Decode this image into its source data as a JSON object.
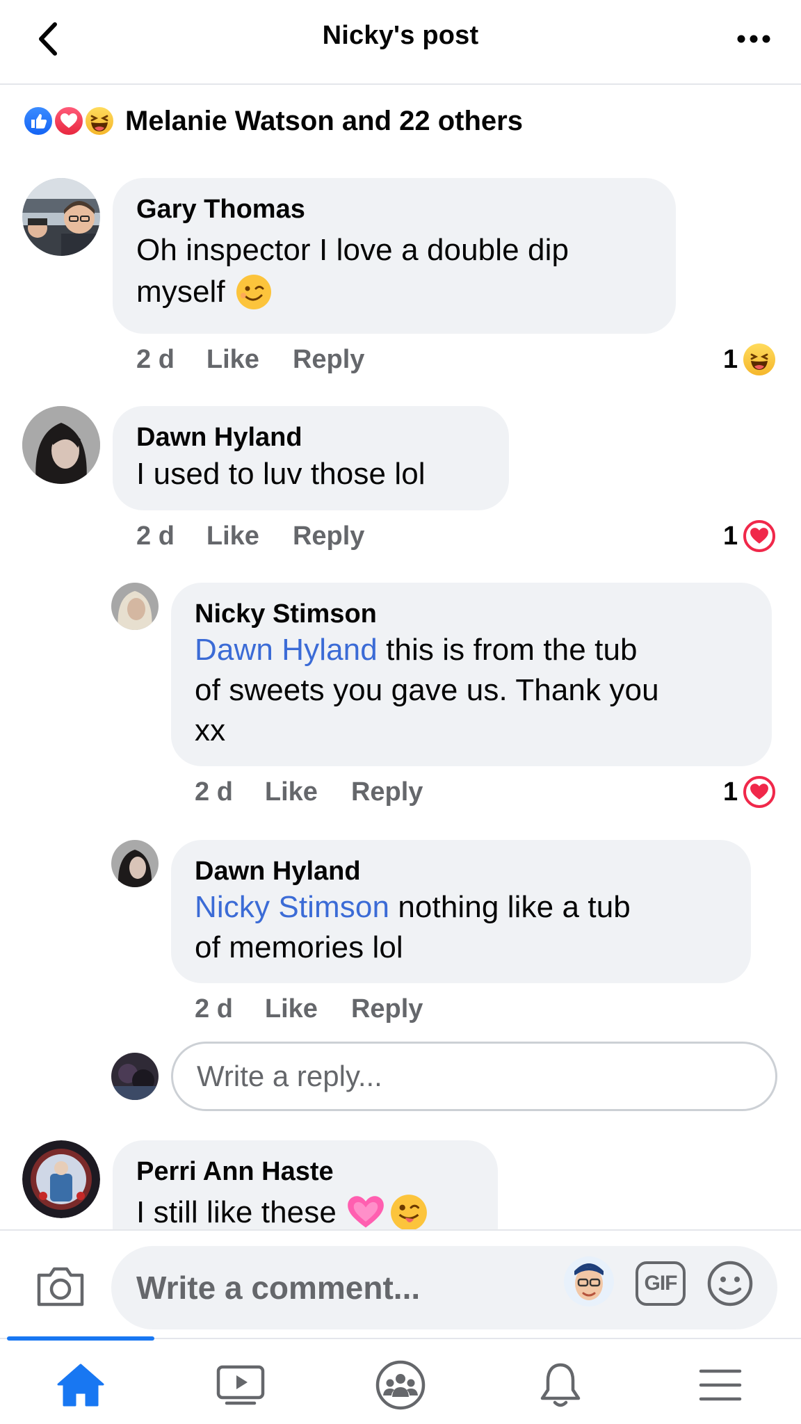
{
  "header": {
    "title": "Nicky's post",
    "back_icon": "chevron-left-icon",
    "more_icon": "more-horizontal-icon"
  },
  "reactions": {
    "icons": [
      "like-icon",
      "love-icon",
      "haha-icon"
    ],
    "summary": "Melanie Watson and 22 others"
  },
  "comments": [
    {
      "author": "Gary Thomas",
      "text_line1": "Oh inspector I love a double dip",
      "text_line2": "myself",
      "emoji": "wink",
      "time": "2 d",
      "like_label": "Like",
      "reply_label": "Reply",
      "reaction_count": "1",
      "reaction_type": "haha"
    },
    {
      "author": "Dawn Hyland",
      "text": "I used to luv those lol",
      "time": "2 d",
      "like_label": "Like",
      "reply_label": "Reply",
      "reaction_count": "1",
      "reaction_type": "love",
      "replies": [
        {
          "author": "Nicky Stimson",
          "mention": "Dawn Hyland",
          "text_line1": " this is from the tub",
          "text_line2": "of sweets you gave us. Thank you",
          "text_line3": "xx",
          "time": "2 d",
          "like_label": "Like",
          "reply_label": "Reply",
          "reaction_count": "1",
          "reaction_type": "love"
        },
        {
          "author": "Dawn Hyland",
          "mention": "Nicky Stimson",
          "text_line1": " nothing like a tub",
          "text_line2": "of memories lol",
          "time": "2 d",
          "like_label": "Like",
          "reply_label": "Reply"
        }
      ],
      "reply_placeholder": "Write a reply..."
    },
    {
      "author": "Perri Ann Haste",
      "text": "I still like these",
      "emojis": [
        "pink-heart",
        "winking-tongue"
      ]
    }
  ],
  "composer": {
    "placeholder": "Write a comment...",
    "camera_icon": "camera-icon",
    "gif_label": "GIF",
    "emoji_icon": "smiley-icon"
  },
  "tabbar": {
    "items": [
      "home-icon",
      "watch-icon",
      "groups-icon",
      "notifications-icon",
      "menu-icon"
    ],
    "active": "home-icon",
    "active_color": "#1877f2"
  },
  "colors": {
    "mention": "#3b6bd6",
    "bubble": "#f0f2f5",
    "secondary_text": "#65676b"
  }
}
